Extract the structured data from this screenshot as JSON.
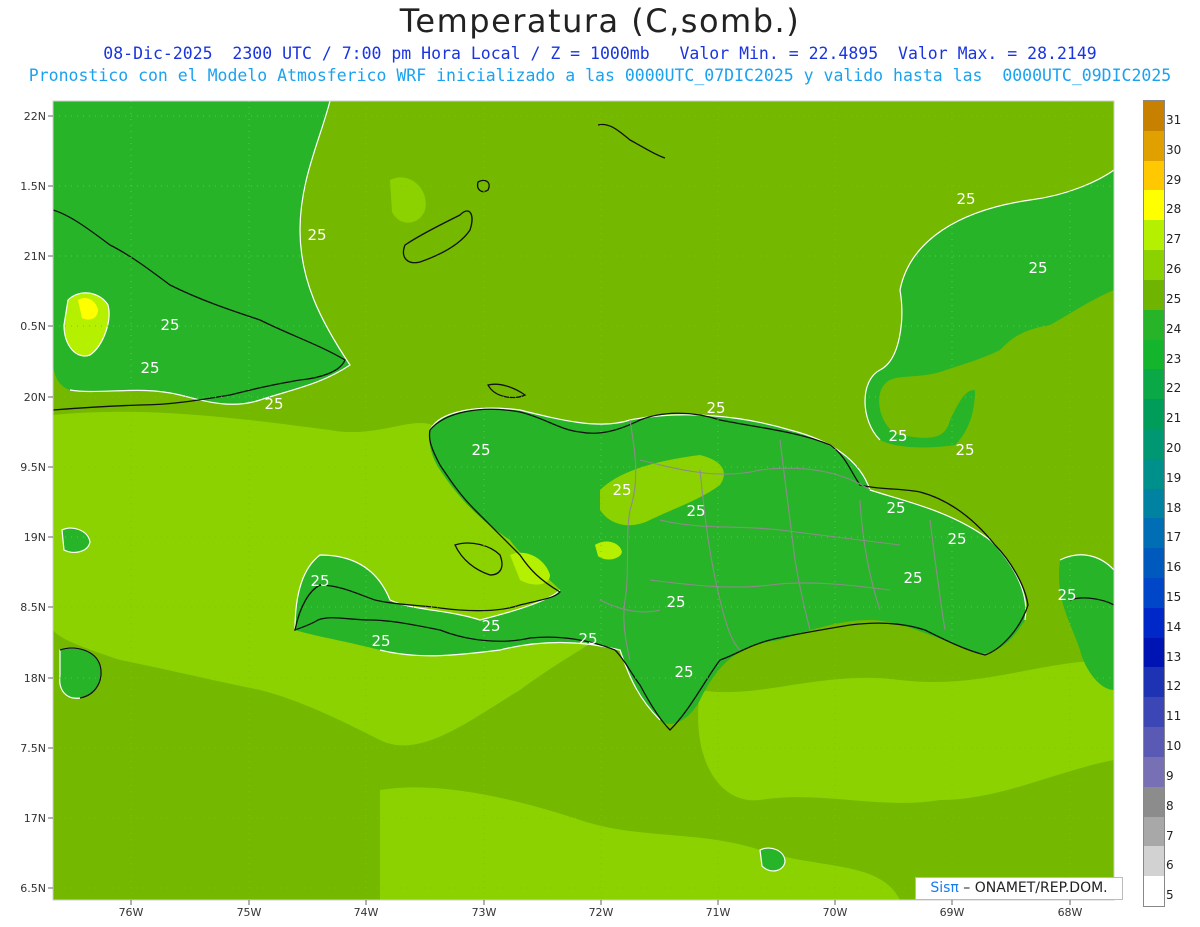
{
  "title": "Temperatura (C,somb.)",
  "subtitle_line1": "08-Dic-2025  2300 UTC / 7:00 pm Hora Local / Z = 1000mb   Valor Min. = 22.4895  Valor Max. = 28.2149",
  "subtitle_line2": "Pronostico con el Modelo Atmosferico WRF inicializado a las 0000UTC_07DIC2025 y valido hasta las  0000UTC_09DIC2025",
  "y_ticks": [
    "22N",
    "1.5N",
    "21N",
    "0.5N",
    "20N",
    "9.5N",
    "19N",
    "8.5N",
    "18N",
    "7.5N",
    "17N",
    "6.5N"
  ],
  "x_ticks": [
    "76W",
    "75W",
    "74W",
    "73W",
    "72W",
    "71W",
    "70W",
    "69W",
    "68W"
  ],
  "contour_labels": [
    "25",
    "25",
    "25",
    "25",
    "25",
    "25",
    "25",
    "25",
    "25",
    "25",
    "25",
    "25",
    "25",
    "25",
    "25",
    "25",
    "25",
    "25",
    "25",
    "25"
  ],
  "colorbar": {
    "labels": [
      "31",
      "30",
      "29",
      "28",
      "27",
      "26",
      "25",
      "24",
      "23",
      "22",
      "21",
      "20",
      "19",
      "18",
      "17",
      "16",
      "15",
      "14",
      "13",
      "12",
      "11",
      "10",
      "9",
      "8",
      "7",
      "6",
      "5"
    ],
    "colors": [
      "#c88000",
      "#e0a000",
      "#ffc800",
      "#ffff00",
      "#b4f000",
      "#8cd200",
      "#6eb400",
      "#28b428",
      "#14b42d",
      "#0aa846",
      "#009c5a",
      "#009873",
      "#00908c",
      "#0082a0",
      "#006eb4",
      "#005abe",
      "#0046c8",
      "#0028c8",
      "#0014b4",
      "#1e32b4",
      "#3c46b4",
      "#5a5ab4",
      "#7870b4",
      "#8c8c8c",
      "#a8a8a8",
      "#d2d2d2",
      "#ffffff"
    ]
  },
  "credit": {
    "brand": "Sisπ",
    "text": " – ONAMET/REP.DOM."
  },
  "colors": {
    "field_base": "#74b800",
    "warm": "#8cd200",
    "cool": "#28b428",
    "contour": "#ffffff",
    "coast": "#111111"
  }
}
